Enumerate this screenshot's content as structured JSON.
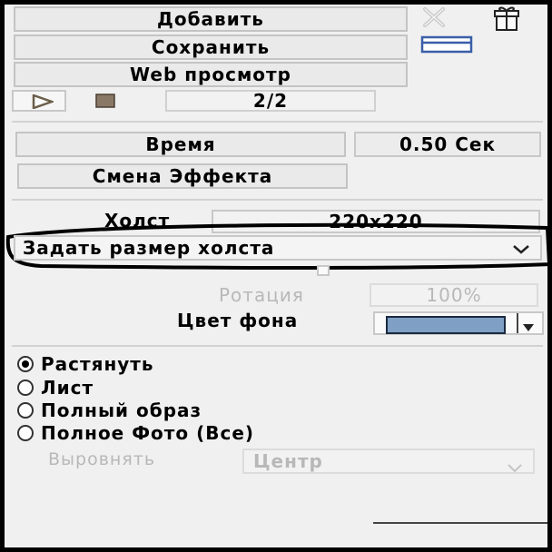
{
  "buttons": {
    "add": "Добавить",
    "save": "Сохранить",
    "web_preview": "Web просмотр",
    "time": "Время",
    "change_effect": "Смена Эффекта"
  },
  "playback": {
    "frame_counter": "2/2"
  },
  "timing": {
    "duration": "0.50 Сек"
  },
  "canvas": {
    "label": "Холст",
    "size_value": "220x220",
    "size_dropdown": "Задать размер холста"
  },
  "rotation": {
    "label": "Ротация",
    "value": "100%"
  },
  "background": {
    "label": "Цвет фона",
    "color": "#7f9fc4"
  },
  "fit_options": [
    {
      "label": "Растянуть",
      "checked": true
    },
    {
      "label": "Лист",
      "checked": false
    },
    {
      "label": "Полный образ",
      "checked": false
    },
    {
      "label": "Полное Фото (Все)",
      "checked": false
    }
  ],
  "align": {
    "label": "Выровнять",
    "value": "Центр"
  },
  "icons": {
    "delete": "close-x-icon",
    "gift": "gift-icon",
    "window": "window-icon",
    "play": "play-icon",
    "stop": "stop-icon",
    "chevron": "chevron-down-icon"
  }
}
